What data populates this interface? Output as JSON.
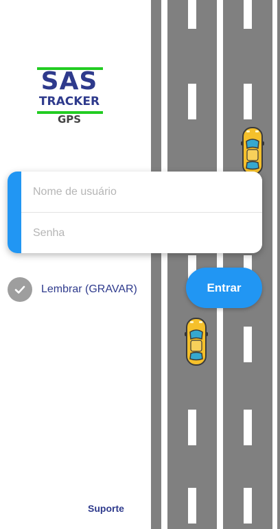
{
  "logo": {
    "line1": "SAS",
    "line2": "TRACKER",
    "line3": "GPS",
    "brand_color": "#2e3a8c",
    "accent_color": "#22cc22"
  },
  "login": {
    "username_placeholder": "Nome de usuário",
    "username_value": "",
    "password_placeholder": "Senha",
    "password_value": "",
    "accent_color": "#2196f3"
  },
  "remember": {
    "label": "Lembrar (GRAVAR)",
    "checked": true,
    "icon": "check-icon"
  },
  "actions": {
    "enter_label": "Entrar",
    "support_label": "Suporte"
  },
  "background": {
    "road_icon": "road-lanes",
    "car_icon": "yellow-taxi-car-icon",
    "road_color": "#808080",
    "car_color": "#f5c02b"
  }
}
